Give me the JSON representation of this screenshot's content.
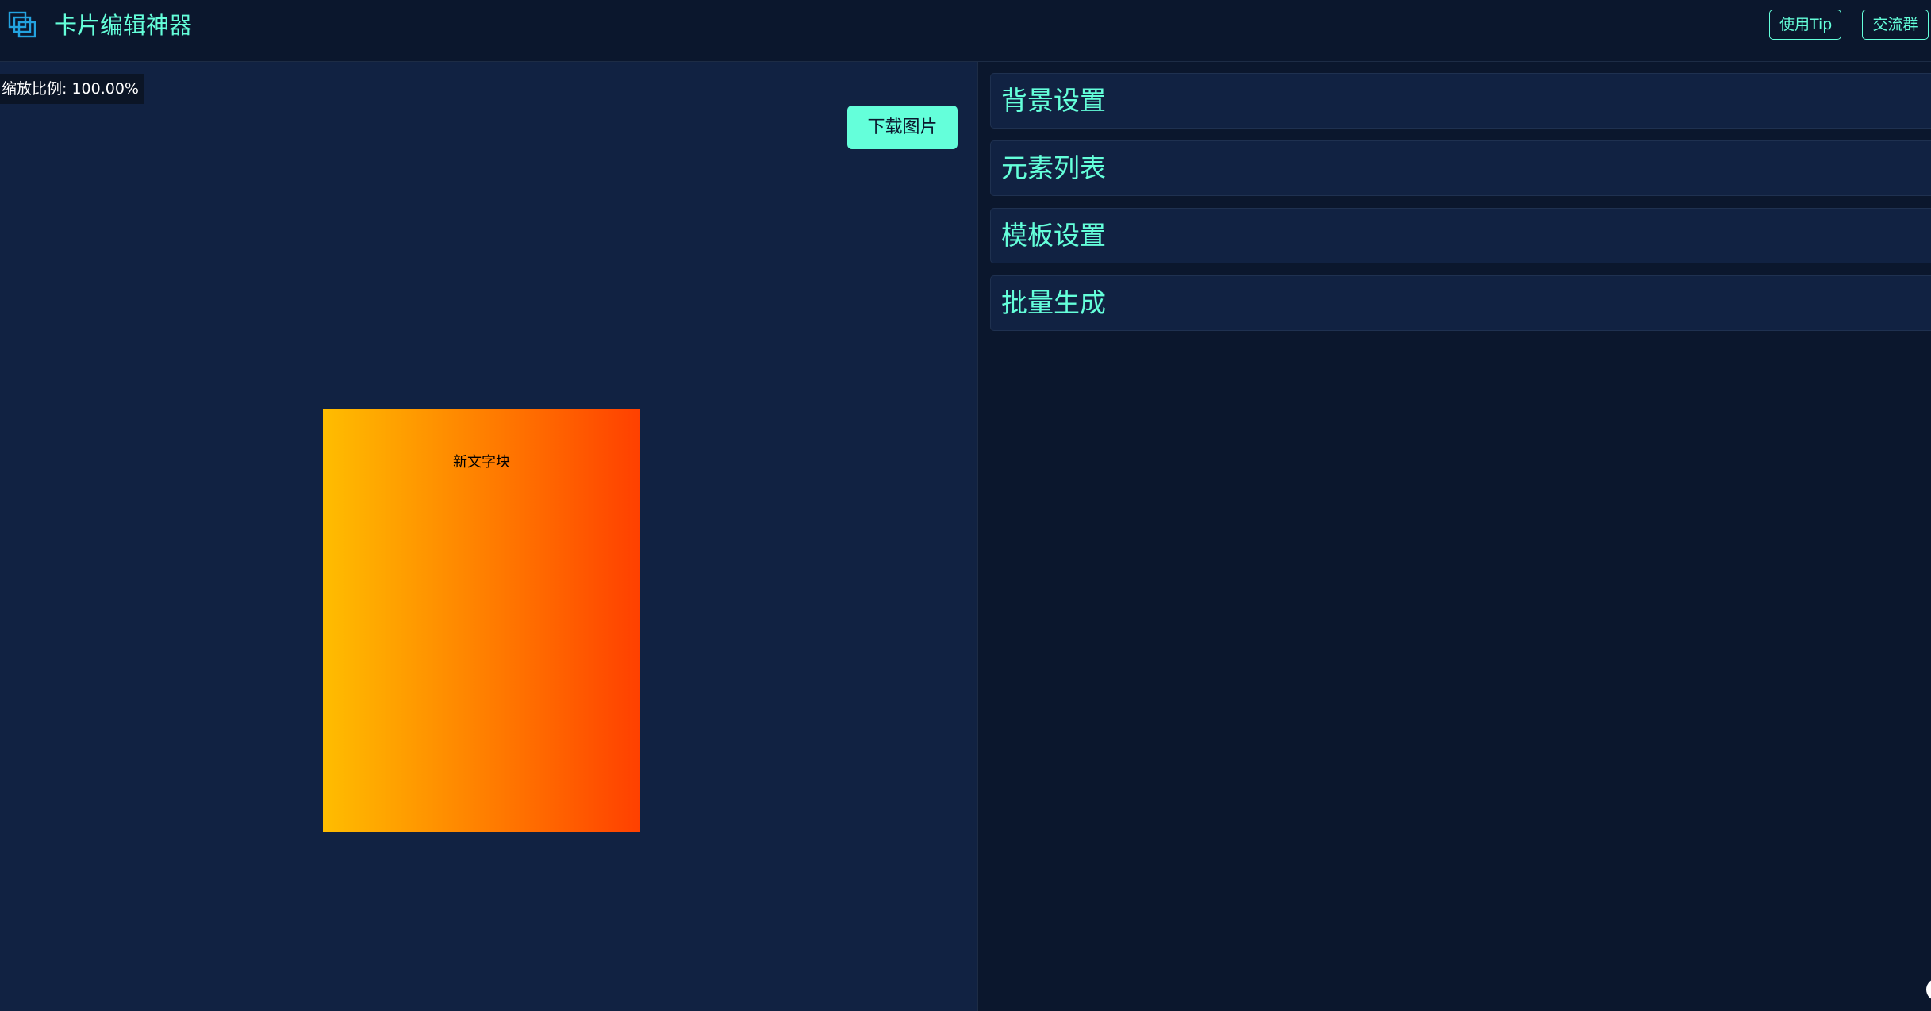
{
  "header": {
    "title": "卡片编辑神器",
    "logo_icon": "layers-icon",
    "tip_button": "使用Tip",
    "group_button": "交流群"
  },
  "canvas": {
    "zoom_label": "缩放比例: 100.00%",
    "download_button": "下载图片",
    "card": {
      "gradient_start": "#ffbd00",
      "gradient_end": "#ff4000",
      "text_block": "新文字块"
    }
  },
  "settings": {
    "sections": [
      {
        "title": "背景设置"
      },
      {
        "title": "元素列表"
      },
      {
        "title": "模板设置"
      },
      {
        "title": "批量生成"
      }
    ]
  },
  "colors": {
    "accent": "#64ffda",
    "background": "#0b172d",
    "panel": "#112242"
  }
}
